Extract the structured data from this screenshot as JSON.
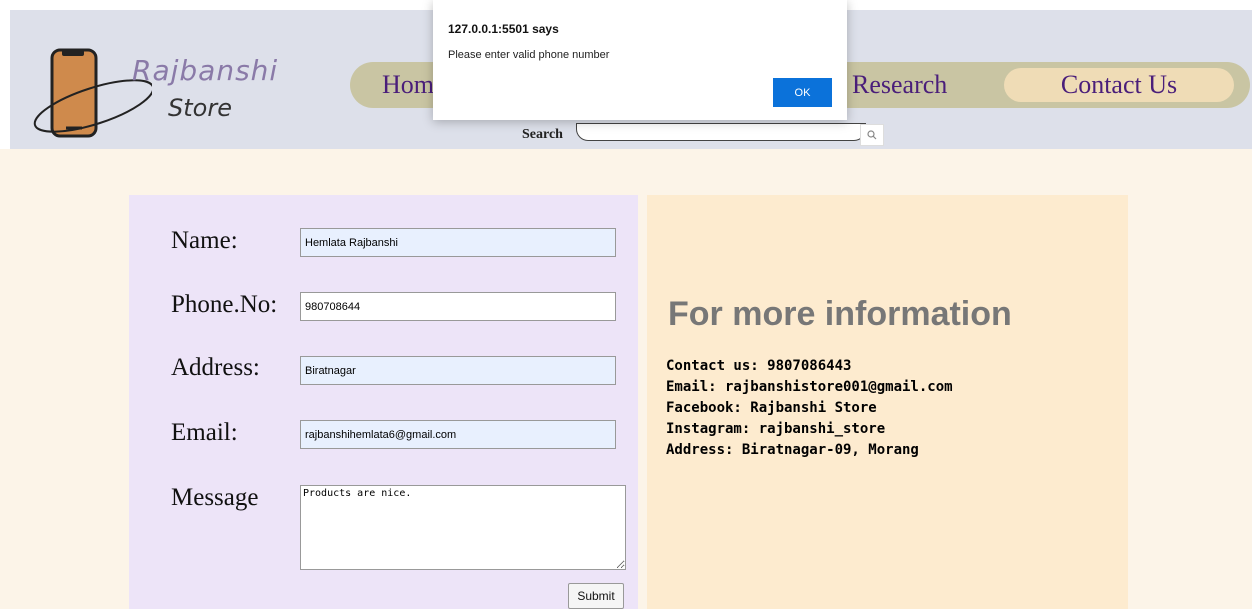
{
  "header": {
    "logo": {
      "word1": "Rajbanshi",
      "word2": "Store"
    },
    "nav": {
      "home": "Home",
      "research": "Research",
      "contact": "Contact Us"
    },
    "search": {
      "label": "Search",
      "value": "",
      "button_icon": "search-icon"
    }
  },
  "form": {
    "name": {
      "label": "Name:",
      "value": "Hemlata Rajbanshi"
    },
    "phone": {
      "label": "Phone.No:",
      "value": "980708644"
    },
    "address": {
      "label": "Address:",
      "value": "Biratnagar"
    },
    "email": {
      "label": "Email:",
      "value": "rajbanshihemlata6@gmail.com"
    },
    "message": {
      "label": "Message",
      "value": "Products are nice."
    },
    "submit_label": "Submit"
  },
  "info": {
    "title": "For more information",
    "lines": [
      "Contact us: 9807086443",
      "Email: rajbanshistore001@gmail.com",
      "Facebook: Rajbanshi Store",
      "Instagram: rajbanshi_store",
      "Address: Biratnagar-09, Morang"
    ]
  },
  "dialog": {
    "title": "127.0.0.1:5501 says",
    "message": "Please enter valid phone number",
    "ok_label": "OK"
  },
  "colors": {
    "header_bg": "#dde0ea",
    "nav_bg": "#c9c5a3",
    "nav_link": "#4a1e7a",
    "contact_highlight": "#efdcb6",
    "page_bg": "#fcf4e8",
    "form_panel_bg": "#ede4f8",
    "info_panel_bg": "#fdebcf",
    "dialog_ok_bg": "#0b72da"
  }
}
